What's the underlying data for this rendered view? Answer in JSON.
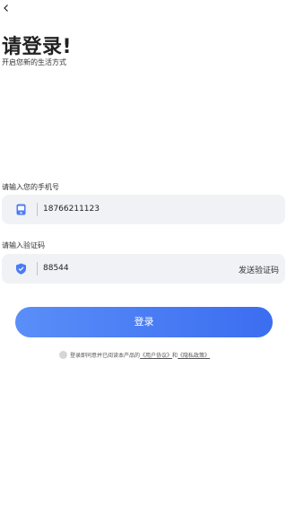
{
  "header": {
    "back_icon": "chevron-left-icon",
    "title": "请登录!",
    "subtitle": "开启您新的生活方式"
  },
  "phone": {
    "label": "请输入您的手机号",
    "icon": "phone-icon",
    "value": "18766211123",
    "icon_color": "#4a7cf6"
  },
  "code": {
    "label": "请输入验证码",
    "icon": "shield-icon",
    "value": "88544",
    "send_label": "发送验证码",
    "icon_color": "#4a7cf6"
  },
  "login": {
    "label": "登录",
    "color_start": "#5a8ef8",
    "color_end": "#3b6df0"
  },
  "agreement": {
    "prefix": "登录即同意并已阅读本产品的",
    "user_agreement": "《用户协议》",
    "and": "和",
    "privacy_policy": "《隐私政策》"
  }
}
